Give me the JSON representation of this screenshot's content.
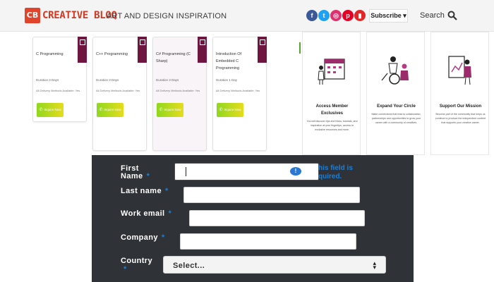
{
  "header": {
    "logo_badge": "CB",
    "logo_text": "CREATIVE BLOQ",
    "tagline": "ART AND DESIGN INSPIRATION",
    "social": [
      {
        "name": "facebook-icon",
        "glyph": "f",
        "color": "#3b5998"
      },
      {
        "name": "twitter-icon",
        "glyph": "t",
        "color": "#1da1f2"
      },
      {
        "name": "instagram-icon",
        "glyph": "◎",
        "color": "#e1306c"
      },
      {
        "name": "pinterest-icon",
        "glyph": "p",
        "color": "#e60023"
      },
      {
        "name": "flipboard-icon",
        "glyph": "▮",
        "color": "#e12828"
      }
    ],
    "subscribe_label": "Subscribe ▾",
    "search_label": "Search"
  },
  "courses": [
    {
      "title": "C Programming",
      "duration": "Duration 3 Days",
      "delivery": "All Delivery Methods Available: Yes",
      "button": "Inquire Now"
    },
    {
      "title": "C++ Programming",
      "duration": "Duration 3 Days",
      "delivery": "All Delivery Methods Available: Yes",
      "button": "Inquire Now"
    },
    {
      "title": "C# Programming (C Sharp)",
      "duration": "Duration 3 Days",
      "delivery": "All Delivery Methods Available: Yes",
      "button": "Inquire Now"
    },
    {
      "title": "Introduction Of Embedded C Programming",
      "duration": "Duration 1 Day",
      "delivery": "All Delivery Methods Available: Yes",
      "button": "Inquire Now"
    }
  ],
  "membership": [
    {
      "title": "Access Member Exclusives",
      "desc": "You will discover tips and tricks, tutorials, and inspiration at your fingertips, access to exclusive resources and more."
    },
    {
      "title": "Expand Your Circle",
      "desc": "Make connections that lead to collaboration, partnerships and opportunities to grow your career with a community of creatives."
    },
    {
      "title": "Support Our Mission",
      "desc": "Become part of the community that helps us continue to produce the independent content that supports your creative career."
    }
  ],
  "form": {
    "first_name_label": "First Name",
    "last_name_label": "Last name",
    "work_email_label": "Work email",
    "company_label": "Company",
    "country_label": "Country",
    "required_marker": "*",
    "tooltip": "his field is quired.",
    "country_select_value": "Select...",
    "accent": "#1f7ed3"
  }
}
